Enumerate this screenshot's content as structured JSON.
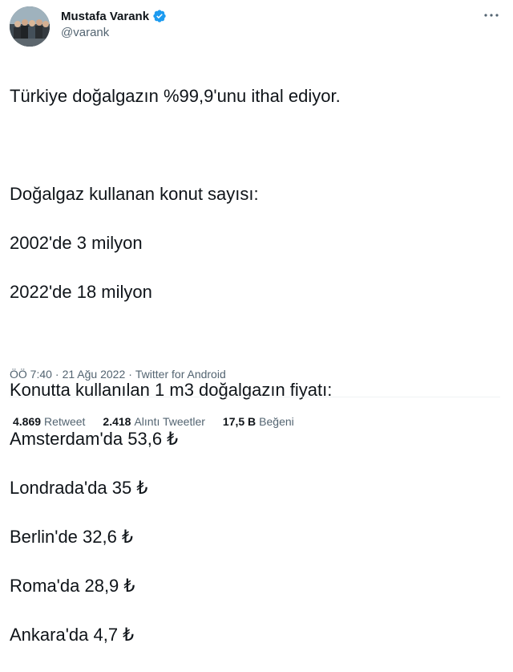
{
  "author": {
    "display_name": "Mustafa Varank",
    "handle": "@varank",
    "verified": true
  },
  "tweet": {
    "lines": [
      "Türkiye doğalgazın %99,9'unu ithal ediyor.",
      "",
      "Doğalgaz kullanan konut sayısı:",
      "2002'de 3 milyon",
      "2022'de 18 milyon",
      "",
      "Konutta kullanılan 1 m3 doğalgazın fiyatı:",
      "Amsterdam'da 53,6 ₺",
      "Londrada'da 35 ₺",
      "Berlin'de 32,6 ₺",
      "Roma'da 28,9 ₺",
      "Ankara'da 4,7 ₺"
    ]
  },
  "meta": {
    "time": "ÖÖ 7:40",
    "separator": "·",
    "date": "21 Ağu 2022",
    "source": "Twitter for Android"
  },
  "stats": {
    "retweets_count": "4.869",
    "retweets_label": "Retweet",
    "quotes_count": "2.418",
    "quotes_label": "Alıntı Tweetler",
    "likes_count": "17,5 B",
    "likes_label": "Beğeni"
  },
  "colors": {
    "text_primary": "#0f1419",
    "text_secondary": "#536471",
    "verified_blue": "#1d9bf0",
    "divider": "#eff3f4"
  },
  "icons": {
    "verified": "verified-badge-icon",
    "more": "more-dots-icon"
  }
}
